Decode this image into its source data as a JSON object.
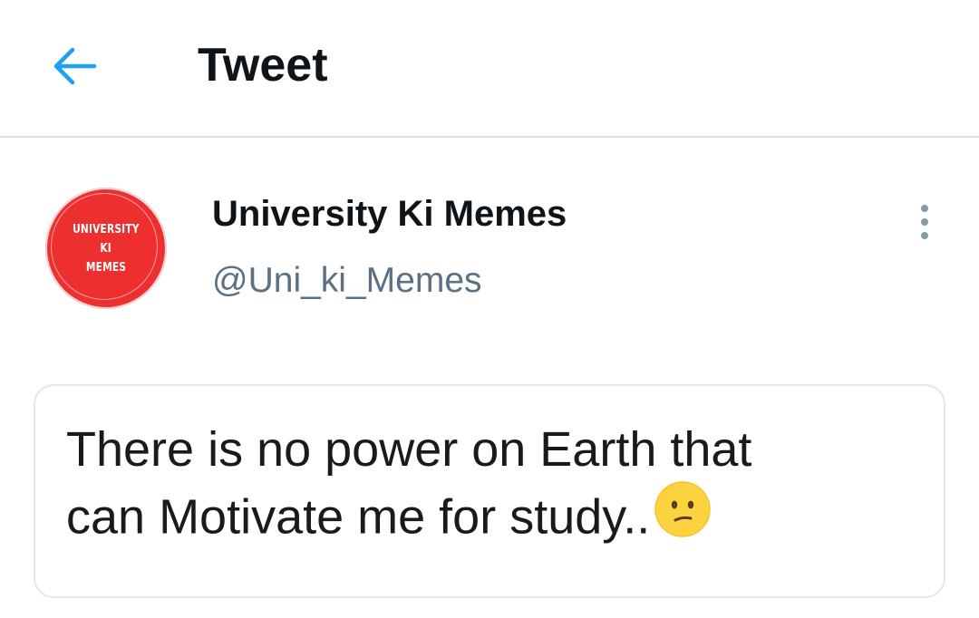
{
  "header": {
    "title": "Tweet",
    "back_icon": "arrow-left-icon",
    "accent_color": "#1da1f2"
  },
  "author": {
    "avatar_text": [
      "UNIVERSITY",
      "KI",
      "MEMES"
    ],
    "avatar_color": "#ee2f30",
    "display_name": "University Ki Memes",
    "handle": "@Uni_ki_Memes"
  },
  "menu": {
    "icon": "more-vertical-icon"
  },
  "tweet": {
    "lines": [
      "There is no power on Earth that",
      "can Motivate me for study.."
    ],
    "emoji": "confused-face-emoji"
  }
}
